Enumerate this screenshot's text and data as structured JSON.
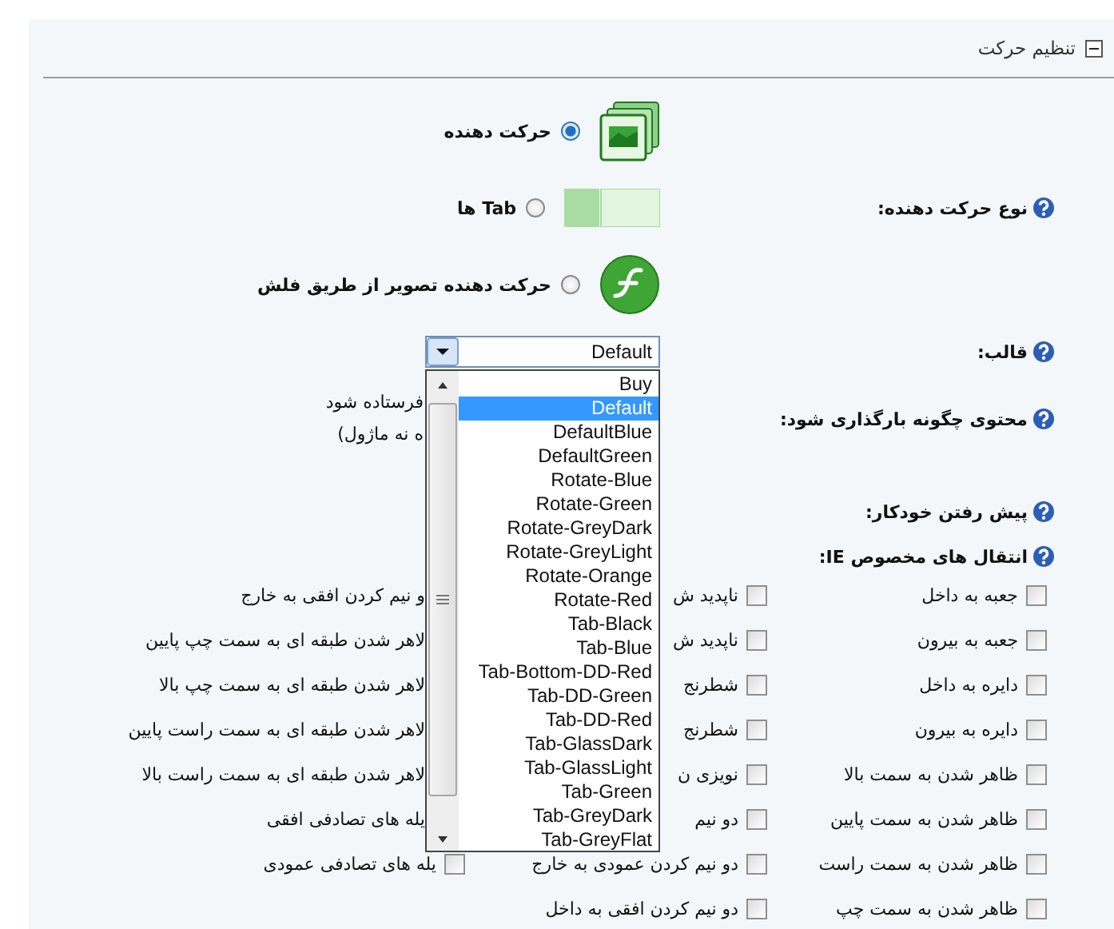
{
  "section": {
    "title": "تنظیم حرکت",
    "expanded": true
  },
  "motion_type": {
    "label": "نوع حرکت دهنده:",
    "options": [
      {
        "label": "حرکت دهنده",
        "selected": true
      },
      {
        "label": "Tab ها",
        "selected": false
      },
      {
        "label": "حرکت دهنده تصویر از طریق فلش",
        "selected": false
      }
    ]
  },
  "template": {
    "label": "قالب:",
    "value": "Default",
    "expanded": true,
    "options": [
      {
        "label": "Buy",
        "selected": false
      },
      {
        "label": "Default",
        "selected": true
      },
      {
        "label": "DefaultBlue",
        "selected": false
      },
      {
        "label": "DefaultGreen",
        "selected": false
      },
      {
        "label": "Rotate-Blue",
        "selected": false
      },
      {
        "label": "Rotate-Green",
        "selected": false
      },
      {
        "label": "Rotate-GreyDark",
        "selected": false
      },
      {
        "label": "Rotate-GreyLight",
        "selected": false
      },
      {
        "label": "Rotate-Orange",
        "selected": false
      },
      {
        "label": "Rotate-Red",
        "selected": false
      },
      {
        "label": "Tab-Black",
        "selected": false
      },
      {
        "label": "Tab-Blue",
        "selected": false
      },
      {
        "label": "Tab-Bottom-DD-Red",
        "selected": false
      },
      {
        "label": "Tab-DD-Green",
        "selected": false
      },
      {
        "label": "Tab-DD-Red",
        "selected": false
      },
      {
        "label": "Tab-GlassDark",
        "selected": false
      },
      {
        "label": "Tab-GlassLight",
        "selected": false
      },
      {
        "label": "Tab-Green",
        "selected": false
      },
      {
        "label": "Tab-GreyDark",
        "selected": false
      },
      {
        "label": "Tab-GreyFlat",
        "selected": false
      }
    ]
  },
  "content_load": {
    "label": "محتوی چگونه بارگذاری شود:",
    "lines": [
      "فرستاده شود",
      "ه نه ماژول)"
    ]
  },
  "autoplay": {
    "label": "پیش رفتن خودکار:"
  },
  "ie_transitions": {
    "label": "انتقال های مخصوص IE:",
    "rows": [
      {
        "cells": [
          {
            "label": "جعبه به داخل",
            "checked": false
          },
          {
            "label": "ناپدید ش",
            "checked": false
          },
          {
            "label": "و نیم کردن افقی به خارج"
          }
        ]
      },
      {
        "cells": [
          {
            "label": "جعبه به بیرون",
            "checked": false
          },
          {
            "label": "ناپدید ش",
            "checked": false
          },
          {
            "label": "لاهر شدن طبقه ای به سمت چپ پایین"
          }
        ]
      },
      {
        "cells": [
          {
            "label": "دایره به داخل",
            "checked": false
          },
          {
            "label": "شطرنج",
            "checked": false
          },
          {
            "label": "لاهر شدن طبقه ای به سمت چپ بالا"
          }
        ]
      },
      {
        "cells": [
          {
            "label": "دایره به بیرون",
            "checked": false
          },
          {
            "label": "شطرنج",
            "checked": false
          },
          {
            "label": "لاهر شدن طبقه ای به سمت راست پایین"
          }
        ]
      },
      {
        "cells": [
          {
            "label": "ظاهر شدن به سمت بالا",
            "checked": false
          },
          {
            "label": "نویزی ن",
            "checked": false
          },
          {
            "label": "لاهر شدن طبقه ای به سمت راست بالا"
          }
        ]
      },
      {
        "cells": [
          {
            "label": "ظاهر شدن به سمت پایین",
            "checked": false
          },
          {
            "label": "دو نیم",
            "checked": false
          },
          {
            "label": "یله های تصادفی افقی"
          }
        ]
      },
      {
        "cells": [
          {
            "label": "ظاهر شدن به سمت راست",
            "checked": false
          },
          {
            "label": "دو نیم کردن عمودی به خارج",
            "checked": false
          },
          {
            "label": "یله های تصادفی عمودی",
            "checked": false
          }
        ]
      },
      {
        "cells": [
          {
            "label": "ظاهر شدن به سمت چپ",
            "checked": false
          },
          {
            "label": "دو نیم کردن افقی به داخل",
            "checked": false
          }
        ]
      }
    ]
  }
}
